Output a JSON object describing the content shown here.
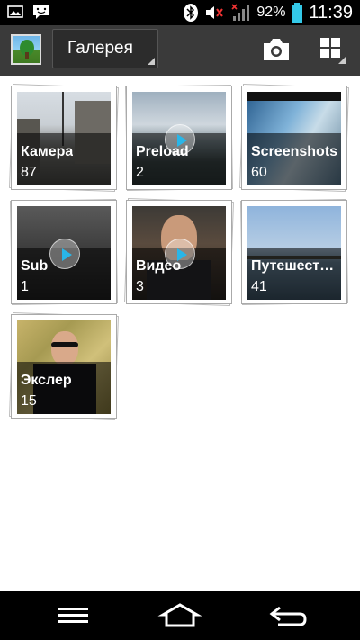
{
  "status_bar": {
    "notification_icons": [
      "gallery-notification-icon",
      "message-notification-icon"
    ],
    "battery_percent": "92%",
    "time": "11:39"
  },
  "action_bar": {
    "album_selector": "Галерея",
    "icons": [
      "camera-icon",
      "grid-view-icon"
    ]
  },
  "albums": [
    {
      "name": "Камера",
      "count": "87",
      "video": false
    },
    {
      "name": "Preload",
      "count": "2",
      "video": true
    },
    {
      "name": "Screenshots",
      "count": "60",
      "video": false
    },
    {
      "name": "Sub",
      "count": "1",
      "video": true
    },
    {
      "name": "Видео",
      "count": "3",
      "video": true
    },
    {
      "name": "Путешествия",
      "count": "41",
      "video": false
    },
    {
      "name": "Экслер",
      "count": "15",
      "video": false
    }
  ],
  "nav_bar": {
    "icons": [
      "menu-icon",
      "home-icon",
      "back-icon"
    ]
  },
  "colors": {
    "status_bar": "#000000",
    "action_bar": "#3a3a3a",
    "accent_battery": "#33c9e8",
    "play_accent": "#29b6e8"
  }
}
